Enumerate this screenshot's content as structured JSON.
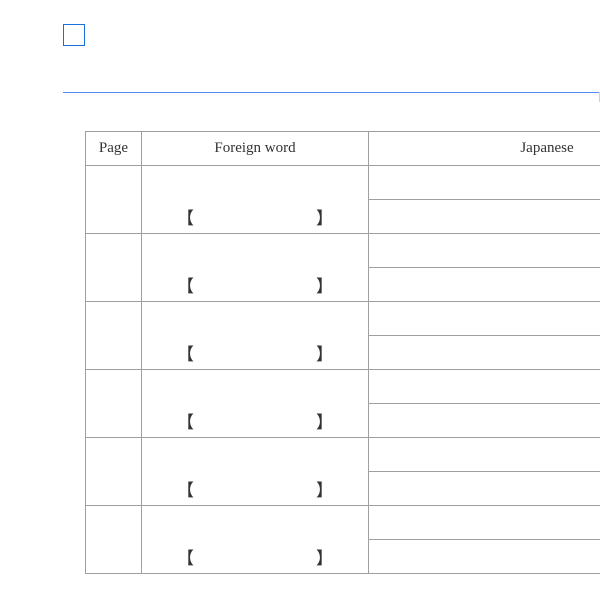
{
  "headers": {
    "page": "Page",
    "foreign_word": "Foreign word",
    "japanese": "Japanese"
  },
  "brackets": {
    "open": "【",
    "close": "】"
  },
  "rows": [
    {
      "page": "",
      "foreign_word": "",
      "japanese_top": "",
      "japanese_bottom": ""
    },
    {
      "page": "",
      "foreign_word": "",
      "japanese_top": "",
      "japanese_bottom": ""
    },
    {
      "page": "",
      "foreign_word": "",
      "japanese_top": "",
      "japanese_bottom": ""
    },
    {
      "page": "",
      "foreign_word": "",
      "japanese_top": "",
      "japanese_bottom": ""
    },
    {
      "page": "",
      "foreign_word": "",
      "japanese_top": "",
      "japanese_bottom": ""
    },
    {
      "page": "",
      "foreign_word": "",
      "japanese_top": "",
      "japanese_bottom": ""
    }
  ]
}
